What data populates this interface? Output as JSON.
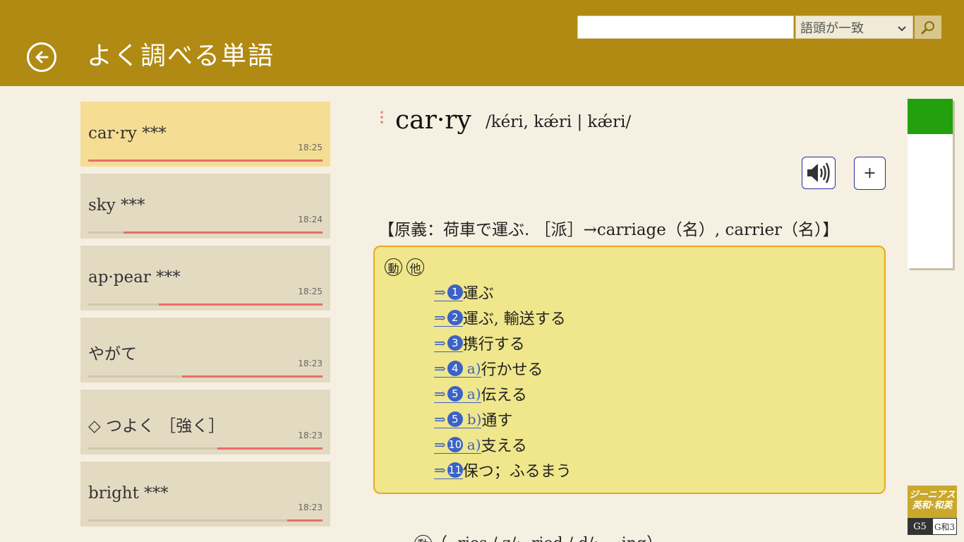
{
  "header": {
    "title": "よく調べる単語",
    "search_placeholder": "",
    "search_mode": "語頭が一致"
  },
  "history": [
    {
      "word": "car·ry ***",
      "time": "18:25",
      "progress": 0.0,
      "selected": true
    },
    {
      "word": "sky ***",
      "time": "18:24",
      "progress": 0.15
    },
    {
      "word": "ap·pear ***",
      "time": "18:25",
      "progress": 0.3
    },
    {
      "word": "やがて",
      "time": "18:23",
      "progress": 0.4
    },
    {
      "word": "◇ つよく ［強く］",
      "time": "18:23",
      "progress": 0.55
    },
    {
      "word": "bright ***",
      "time": "18:23",
      "progress": 0.85
    }
  ],
  "entry": {
    "stars": "***",
    "headword": "car·ry",
    "pronunciation": "/kéri, kǽri | kǽri/",
    "etymology": "【原義：荷車で運ぶ. ［派］→carriage（名）, carrier（名）】",
    "pos_marks": [
      "動",
      "他"
    ],
    "senses": [
      {
        "num": "1",
        "sub": "",
        "gloss": "運ぶ"
      },
      {
        "num": "2",
        "sub": "",
        "gloss": "運ぶ, 輸送する"
      },
      {
        "num": "3",
        "sub": "",
        "gloss": "携行する"
      },
      {
        "num": "4",
        "sub": "a)",
        "gloss": "行かせる"
      },
      {
        "num": "5",
        "sub": "a)",
        "gloss": "伝える"
      },
      {
        "num": "5",
        "sub": "b)",
        "gloss": "通す"
      },
      {
        "num": "10",
        "sub": "a)",
        "gloss": "支える"
      },
      {
        "num": "11",
        "sub": "",
        "gloss": "保つ；ふるまう"
      }
    ],
    "arrow": "⇒",
    "bottom_pos": "動",
    "bottom_text": "（ -ries /-z/; -ried /-d/; ~·ing）"
  },
  "logo": {
    "line1": "ジーニアス",
    "line2": "英和·和英",
    "g5": "G5",
    "gk3": "G和3"
  },
  "colors": {
    "header": "#b08a12",
    "accent_blue": "#3b62c4",
    "progress_red": "#e86c6c",
    "scroll_green": "#22a00e"
  }
}
